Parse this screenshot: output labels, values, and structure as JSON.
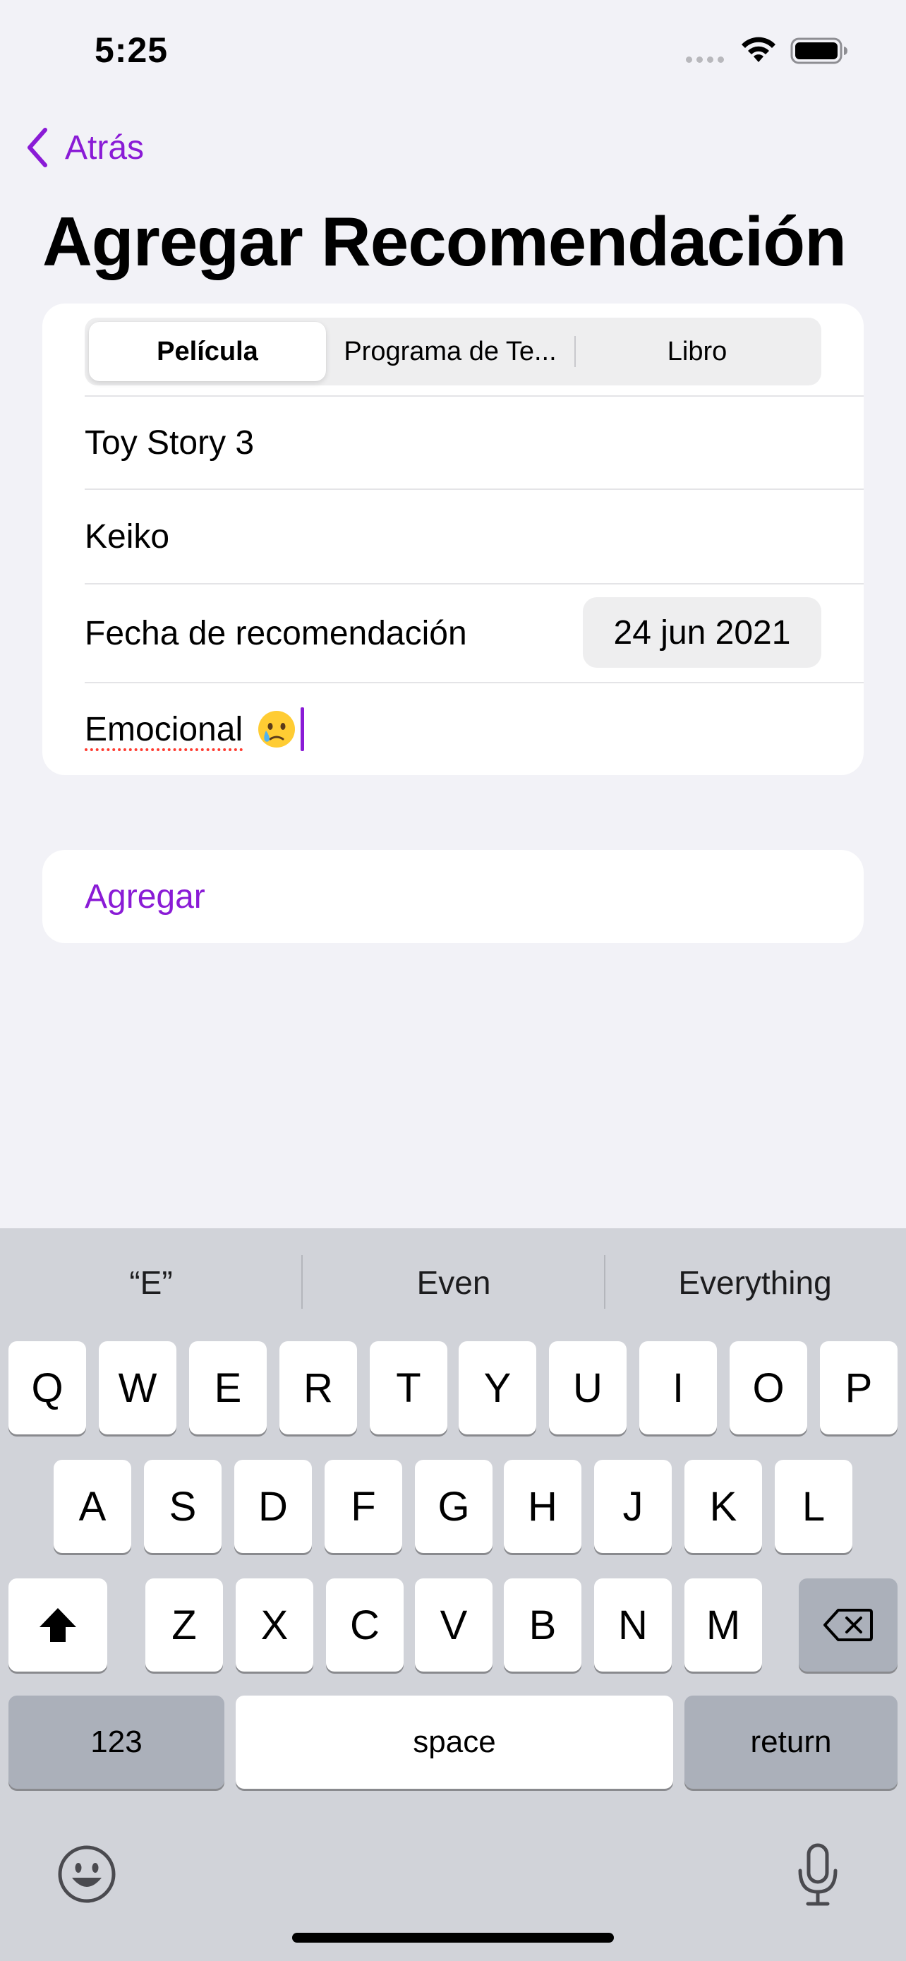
{
  "status_bar": {
    "time": "5:25"
  },
  "nav": {
    "back_label": "Atrás",
    "title": "Agregar Recomendación"
  },
  "form": {
    "segments": [
      "Película",
      "Programa de Te...",
      "Libro"
    ],
    "selected_segment": "Película",
    "title_value": "Toy Story 3",
    "recommender_value": "Keiko",
    "date_label": "Fecha de recomendación",
    "date_value": "24 jun 2021",
    "notes_value": "Emocional",
    "notes_emoji": "crying-face-icon"
  },
  "add_button_label": "Agregar",
  "keyboard": {
    "suggestions": [
      "“E”",
      "Even",
      "Everything"
    ],
    "row1": [
      "Q",
      "W",
      "E",
      "R",
      "T",
      "Y",
      "U",
      "I",
      "O",
      "P"
    ],
    "row2": [
      "A",
      "S",
      "D",
      "F",
      "G",
      "H",
      "J",
      "K",
      "L"
    ],
    "row3": [
      "Z",
      "X",
      "C",
      "V",
      "B",
      "N",
      "M"
    ],
    "numbers_label": "123",
    "space_label": "space",
    "return_label": "return"
  },
  "colors": {
    "accent": "#8a1bd6",
    "background": "#f2f2f7",
    "keyboard": "#d1d3d9"
  }
}
